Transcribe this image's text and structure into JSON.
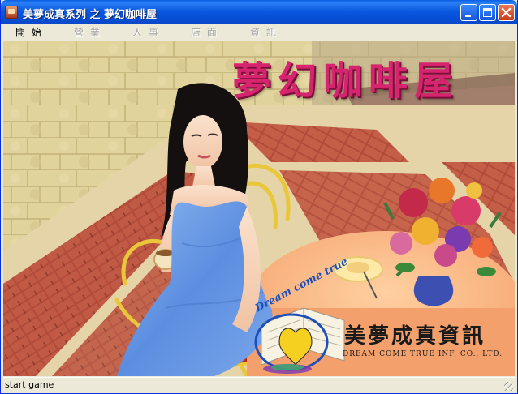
{
  "window": {
    "title": "美夢成真系列 之 夢幻咖啡屋",
    "icon": "coffee-app-icon",
    "buttons": {
      "minimize": "minimize-icon",
      "maximize": "maximize-icon",
      "close": "close-icon"
    }
  },
  "menu": {
    "items": [
      {
        "label": "開 始",
        "enabled": true
      },
      {
        "label": "營 業",
        "enabled": false
      },
      {
        "label": "人 事",
        "enabled": false
      },
      {
        "label": "店 面",
        "enabled": false
      },
      {
        "label": "資 訊",
        "enabled": false
      }
    ]
  },
  "splash": {
    "game_title": "夢幻咖啡屋",
    "logo_text": "Dream come true",
    "company_cn": "美夢成真資訊",
    "company_en": "DREAM COME TRUE INF. CO., LTD."
  },
  "status": {
    "text": "start game"
  },
  "colors": {
    "title_bar": "#0550d8",
    "title_text": "#d6256e",
    "company_text": "#1a1a1a"
  }
}
